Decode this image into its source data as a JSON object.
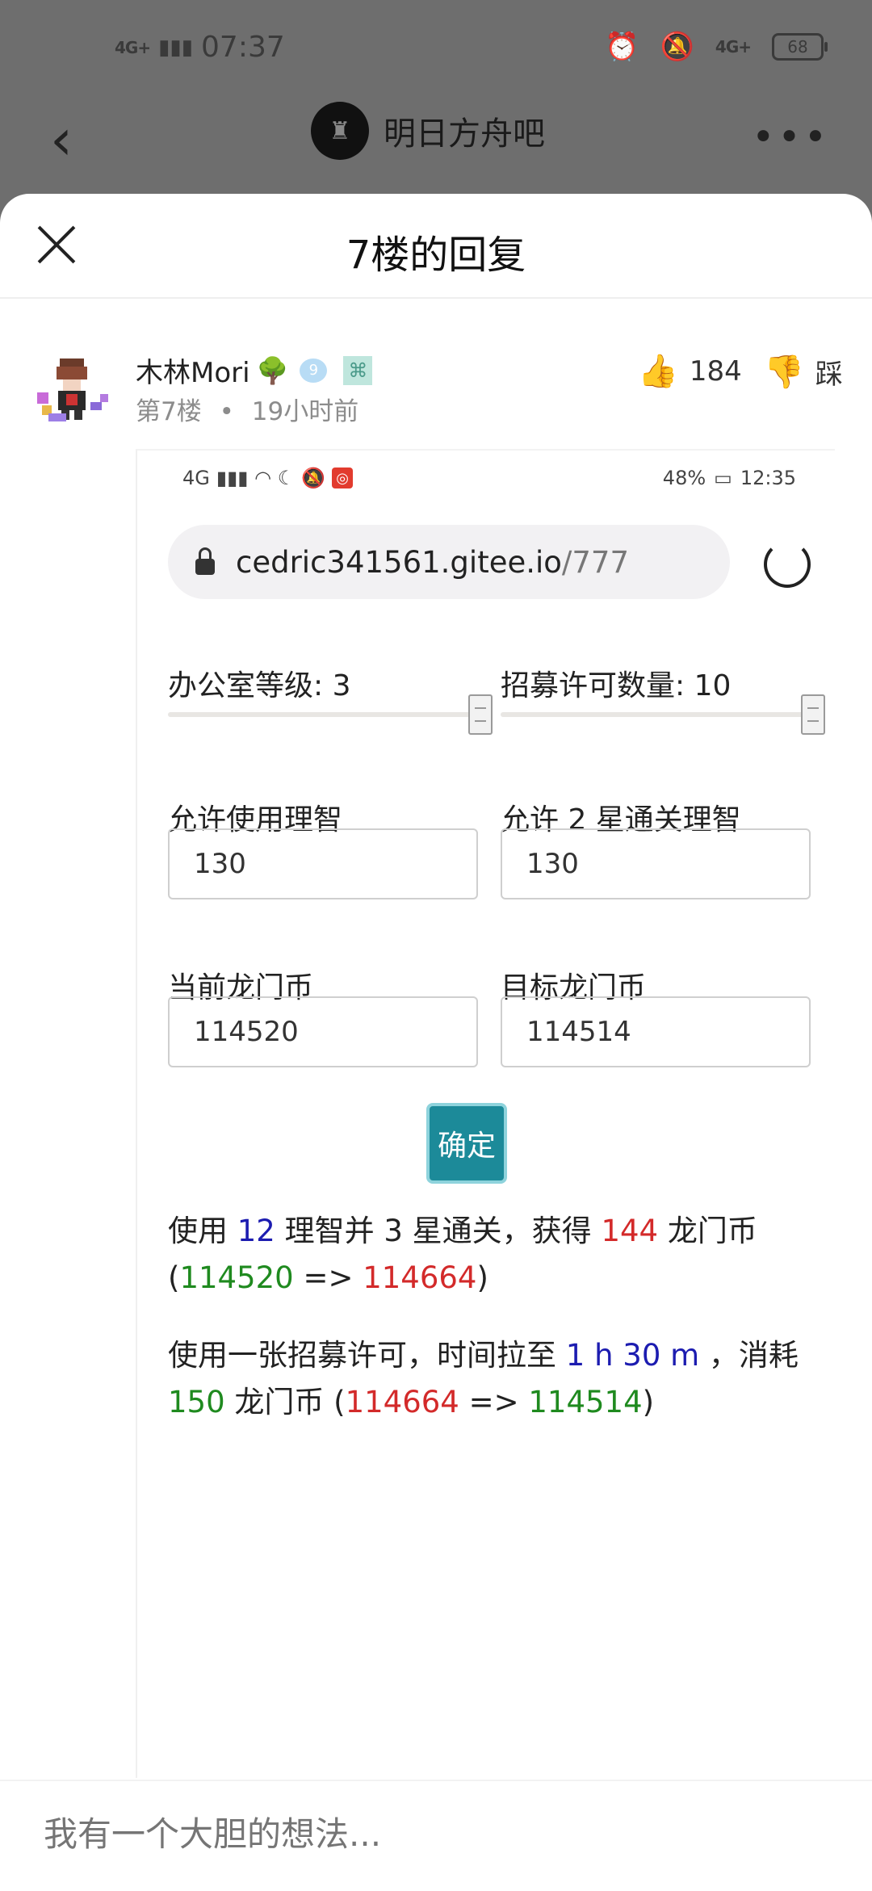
{
  "status_bar": {
    "network": "4G+",
    "time": "07:37",
    "network2": "4G+",
    "battery": "68"
  },
  "header": {
    "forum_name": "明日方舟吧"
  },
  "sheet": {
    "title": "7楼的回复"
  },
  "post": {
    "username": "木林Mori",
    "level": "9",
    "floor": "第7楼",
    "time": "19小时前",
    "likes": "184",
    "dislike_label": "踩"
  },
  "screenshot": {
    "status_left": "4G",
    "battery": "48%",
    "time": "12:35",
    "url_host": "cedric341561.gitee.io",
    "url_path": "/777",
    "office_label": "办公室等级: 3",
    "permit_label": "招募许可数量: 10",
    "sanity_label": "允许使用理智",
    "sanity2_label": "允许 2 星通关理智",
    "sanity_value": "130",
    "sanity2_value": "130",
    "current_label": "当前龙门币",
    "target_label": "目标龙门币",
    "current_value": "114520",
    "target_value": "114514",
    "confirm_label": "确定",
    "result1": {
      "p1": "使用 ",
      "sanity": "12",
      "p2": " 理智并 3 星通关，获得 ",
      "gain": "144",
      "p3": " 龙门币",
      "p4": "(",
      "from": "114520",
      "p5": " => ",
      "to": "114664",
      "p6": ")"
    },
    "result2": {
      "p1": "使用一张招募许可，时间拉至 ",
      "duration": "1 h 30 m",
      "p2": " ，消耗",
      "cost": "150",
      "p3": " 龙门币 (",
      "from": "114664",
      "p4": " => ",
      "to": "114514",
      "p5": ")"
    }
  },
  "comment": {
    "placeholder": "我有一个大胆的想法..."
  }
}
